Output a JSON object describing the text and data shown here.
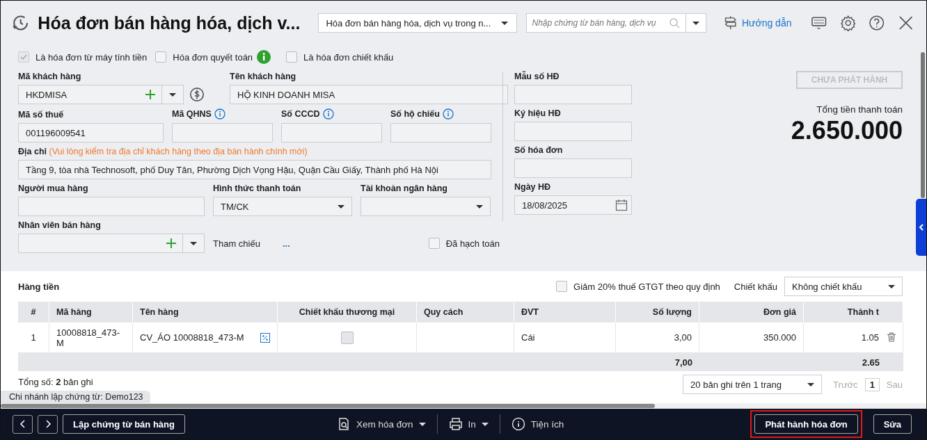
{
  "header": {
    "title": "Hóa đơn bán hàng hóa, dịch v...",
    "template": "Hóa đơn bán hàng hóa, dịch vụ trong n...",
    "search_placeholder": "Nhập chứng từ bán hàng, dịch vụ",
    "guide": "Hướng dẫn"
  },
  "options": [
    {
      "label": "Là hóa đơn từ máy tính tiền",
      "checked": true,
      "disabled": true
    },
    {
      "label": "Hóa đơn quyết toán",
      "checked": false,
      "disabled": false,
      "info": true
    },
    {
      "label": "Là hóa đơn chiết khấu",
      "checked": false,
      "disabled": false
    }
  ],
  "form_rows": [
    [
      {
        "kind": "combo",
        "label": "Mã khách hàng",
        "value": "HKDMISA"
      },
      {
        "kind": "text",
        "label": "Tên khách hàng",
        "value": "HỘ KINH DOANH MISA"
      }
    ],
    [
      {
        "kind": "text",
        "label": "Mã số thuế",
        "value": "001196009541"
      },
      {
        "kind": "text",
        "label": "Mã QHNS",
        "info": true
      },
      {
        "kind": "text",
        "label": "Số CCCD",
        "info": true
      },
      {
        "kind": "text",
        "label": "Số hộ chiếu",
        "info": true
      }
    ],
    [
      {
        "kind": "text",
        "label": "Địa chỉ",
        "note": "(Vui lòng kiểm tra địa chỉ khách hàng theo địa bàn hành chính mới)",
        "value": "Tầng 9, tòa nhà Technosoft, phố Duy Tân, Phường Dịch Vọng Hậu, Quận Cầu Giấy, Thành phố Hà Nội"
      }
    ],
    [
      {
        "kind": "text",
        "label": "Người mua hàng"
      },
      {
        "kind": "select",
        "label": "Hình thức thanh toán",
        "value": "TM/CK"
      },
      {
        "kind": "select",
        "label": "Tài khoản ngân hàng"
      }
    ],
    [
      {
        "kind": "combo",
        "label": "Nhân viên bán hàng"
      },
      {
        "kind": "reference",
        "label": "Tham chiếu",
        "link": "..."
      },
      {
        "kind": "check",
        "label": "Đã hạch toán",
        "checked": false
      }
    ]
  ],
  "invoice_fields": [
    {
      "kind": "text",
      "label": "Mẫu số HĐ"
    },
    {
      "kind": "text",
      "label": "Ký hiệu HĐ"
    },
    {
      "kind": "text",
      "label": "Số hóa đơn"
    },
    {
      "kind": "date",
      "label": "Ngày HĐ",
      "value": "18/08/2025"
    }
  ],
  "status": {
    "label": "CHƯA PHÁT HÀNH",
    "disabled": true
  },
  "total": {
    "label": "Tổng tiền thanh toán",
    "value": "2.650.000"
  },
  "lines": {
    "title": "Hàng tiền",
    "vat_reduction": {
      "label": "Giảm 20% thuế GTGT theo quy định",
      "checked": false
    },
    "discount": {
      "label": "Chiết khấu",
      "value": "Không chiết khấu"
    },
    "columns": [
      {
        "label": "#",
        "kind": "text"
      },
      {
        "label": "Mã hàng",
        "kind": "text"
      },
      {
        "label": "Tên hàng",
        "kind": "text"
      },
      {
        "label": "Chiết khấu thương mại",
        "kind": "check"
      },
      {
        "label": "Quy cách",
        "kind": "text"
      },
      {
        "label": "ĐVT",
        "kind": "text"
      },
      {
        "label": "Số lượng",
        "kind": "text"
      },
      {
        "label": "Đơn giá",
        "kind": "text"
      },
      {
        "label": "Thành t",
        "kind": "text"
      }
    ],
    "rows": [
      {
        "no": "1",
        "code": "10008818_473-M",
        "name": "CV_ÁO 10008818_473-M",
        "trade_discount": false,
        "unit": "Cái",
        "qty": "3,00",
        "price": "350.000",
        "amount": "1.05"
      }
    ],
    "totals": {
      "qty": "7,00",
      "amount": "2.65"
    },
    "count": "Tổng số: **2** bản ghi",
    "page_size": "20 bản ghi trên 1 trang",
    "prev": {
      "label": "Trước",
      "disabled": true
    },
    "page": "1",
    "next": {
      "label": "Sau",
      "disabled": true
    }
  },
  "branch": "Chi nhánh lập chứng từ: Demo123",
  "footer": {
    "create": "Lập chứng từ bán hàng",
    "tools": [
      {
        "kind": "preview",
        "label": "Xem hóa đơn",
        "dropdown": true
      },
      {
        "kind": "print",
        "label": "In",
        "dropdown": true
      },
      {
        "kind": "utility",
        "label": "Tiện ích",
        "dropdown": false
      }
    ],
    "actions": [
      {
        "label": "Phát hành hóa đơn",
        "highlighted": true
      },
      {
        "label": "Sửa",
        "highlighted": false
      }
    ]
  }
}
